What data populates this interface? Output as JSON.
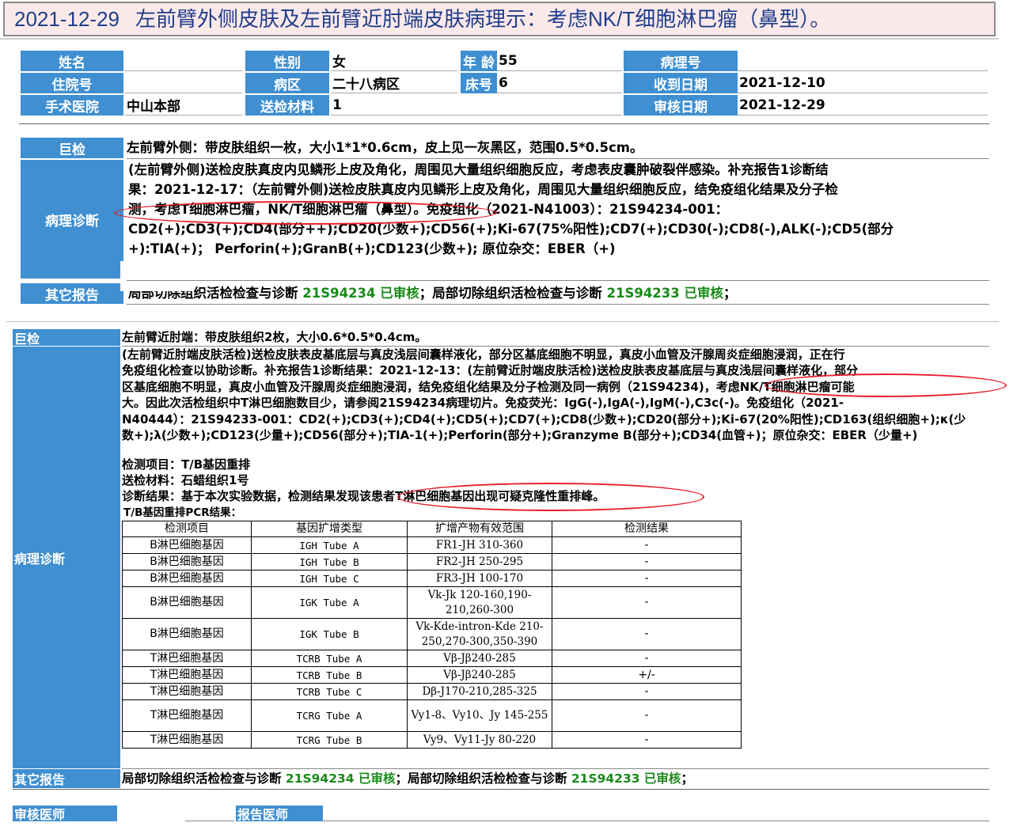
{
  "title": {
    "date": "2021-12-29",
    "text": "左前臂外侧皮肤及左前臂近肘端皮肤病理示：考虑NK/T细胞淋巴瘤（鼻型）。"
  },
  "header": {
    "name_label": "姓名",
    "name_value": "",
    "sex_label": "性别",
    "sex_value": "女",
    "age_label": "年 龄",
    "age_value": "55",
    "pathno_label": "病理号",
    "pathno_value": "",
    "admission_label": "住院号",
    "admission_value": "",
    "ward_label": "病区",
    "ward_value": "二十八病区",
    "bed_label": "床号",
    "bed_value": "6",
    "received_label": "收到日期",
    "received_value": "2021-12-10",
    "hospital_label": "手术医院",
    "hospital_value": "中山本部",
    "material_label": "送检材料",
    "material_value": "1",
    "review_label": "审核日期",
    "review_value": "2021-12-29"
  },
  "section1": {
    "gross_label": "巨检",
    "gross_text": "左前臂外侧：带皮肤组织一枚，大小1*1*0.6cm，皮上见一灰黑区，范围0.5*0.5cm。",
    "diag_label": "病理诊断",
    "diag_lines": [
      "(左前臂外侧)送检皮肤真皮内见鳞形上皮及角化，周围见大量组织细胞反应，考虑表皮囊肿破裂伴感染。补充报告1诊断结",
      "果：2021-12-17：（左前臂外侧)送检皮肤真皮内见鳞形上皮及角化，周围见大量组织细胞反应，结免疫组化结果及分子检",
      "测，考虑T细胞淋巴瘤，NK/T细胞淋巴瘤（鼻型）。免疫组化（2021-N41003）：21S94234-001：",
      "CD2(+);CD3(+);CD4(部分++);CD20(少数+);CD56(+);Ki-67(75%阳性);CD7(+);CD30(-);CD8(-),ALK(-);CD5(部分",
      "+):TIA(+)； Perforin(+);GranB(+);CD123(少数+); 原位杂交：EBER（+)"
    ],
    "other_label": "其它报告",
    "other_a": "局部切除组织活检检查与诊断 ",
    "other_b": "21S94234 已审核",
    "other_c": "；局部切除组织活检检查与诊断 ",
    "other_d": "21S94233 已审核",
    "other_e": "；"
  },
  "section2": {
    "gross_label": "巨检",
    "gross_text": "左前臂近肘端：带皮肤组织2枚，大小0.6*0.5*0.4cm。",
    "diag_label": "病理诊断",
    "diag_lines": [
      "(左前臂近肘端皮肤活检)送检皮肤表皮基底层与真皮浅层间囊样液化，部分区基底细胞不明显，真皮小血管及汗腺周炎症细胞浸润，正在行",
      "免疫组化检查以协助诊断。补充报告1诊断结果：2021-12-13：(左前臂近肘端皮肤活检)送检皮肤表皮基底层与真皮浅层间囊样液化，部分",
      "区基底细胞不明显，真皮小血管及汗腺周炎症细胞浸润，结免疫组化结果及分子检测及同一病例（21S94234)，考虑NK/T细胞淋巴瘤可能",
      "大。因此次活检组织中T淋巴细胞数目少，请参阅21S94234病理切片。免疫荧光：IgG(-),IgA(-),IgM(-),C3c(-)。免疫组化（2021-",
      "N40444）：21S94233-001：CD2(+);CD3(+);CD4(+);CD5(+);CD7(+);CD8(少数+);CD20(部分+);Ki-67(20%阳性);CD163(组织细胞+);κ(少",
      "数+);λ(少数+);CD123(少量+);CD56(部分+);TIA-1(+);Perforin(部分+);Granzyme B(部分+);CD34(血管+)；原位杂交：EBER（少量+)"
    ],
    "test_item": "检测项目：T/B基因重排",
    "test_material": "送检材料：石蜡组织1号",
    "test_result": "诊断结果：基于本次实验数据，检测结果发现该患者T淋巴细胞基因出现可疑克隆性重排峰。",
    "pcr_caption": "T/B基因重排PCR结果：",
    "table": {
      "headers": [
        "检测项目",
        "基因扩增类型",
        "扩增产物有效范围",
        "检测结果"
      ],
      "rows": [
        [
          "B淋巴细胞基因",
          "IGH Tube A",
          "FR1-JH 310-360",
          "-"
        ],
        [
          "B淋巴细胞基因",
          "IGH Tube B",
          "FR2-JH 250-295",
          "-"
        ],
        [
          "B淋巴细胞基因",
          "IGH Tube C",
          "FR3-JH 100-170",
          "-"
        ],
        [
          "B淋巴细胞基因",
          "IGK Tube A",
          "Vk-Jk 120-160,190-210,260-300",
          "-"
        ],
        [
          "B淋巴细胞基因",
          "IGK Tube B",
          "Vk-Kde-intron-Kde 210-250,270-300,350-390",
          "-"
        ],
        [
          "T淋巴细胞基因",
          "TCRB Tube A",
          "Vβ-Jβ240-285",
          "-"
        ],
        [
          "T淋巴细胞基因",
          "TCRB Tube B",
          "Vβ-Jβ240-285",
          "+/-"
        ],
        [
          "T淋巴细胞基因",
          "TCRB Tube C",
          "Dβ-J170-210,285-325",
          "-"
        ],
        [
          "T淋巴细胞基因",
          "TCRG Tube A",
          "Vy1-8、Vy10、Jy 145-255",
          "-"
        ],
        [
          "T淋巴细胞基因",
          "TCRG Tube B",
          "Vy9、Vy11-Jy 80-220",
          "-"
        ]
      ]
    },
    "other_label": "其它报告",
    "other_a": "局部切除组织活检检查与诊断 ",
    "other_b": "21S94234 已审核",
    "other_c": "；局部切除组织活检检查与诊断 ",
    "other_d": "21S94233 已审核",
    "other_e": "；"
  },
  "footer": {
    "reviewer_label": "审核医师",
    "reporter_label": "报告医师"
  },
  "colors": {
    "label_bg": "#3f8fd1",
    "status_green": "#1a8a1a",
    "annotation_red": "#e8202a",
    "title_text": "#1f3d8a"
  }
}
